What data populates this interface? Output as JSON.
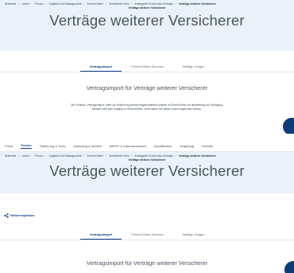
{
  "breadcrumb": {
    "items": [
      "Startseite",
      "Leben",
      "Firmen",
      "Digitales bAV-Management",
      "FirmenOnline",
      "Vertiefende Infos",
      "Arbeitgeber-Portal bAV-Verträge"
    ],
    "current": "Verträge weiterer Versicherer"
  },
  "page_title": "Verträge weiterer Versicherer",
  "top_nav": [
    "Privat",
    "Firmen",
    "Tarifierung & Tools",
    "Marketing & Medien",
    "BiPRO & Datenaustausch",
    "Qualifikation",
    "Vergütung",
    "Kontakt"
  ],
  "top_nav_active": "Firmen",
  "tabs": [
    "Vertragsimport",
    "FirmenOnline Services",
    "Häufige Fragen"
  ],
  "active_tab": "Vertragsimport",
  "section_title": "Vertragsimport für Verträge weiterer Versicherer",
  "intro_text": {
    "line1": "Die Funktion „Vertragsimport“ steht zur Einführung bereits freigeschalteten Nutzern in FirmenOnline zur Bearbeitung zur Verfügung.",
    "line2": "Besteht noch kein Zugang zu FirmenOnline, muss dieser wie üblich vorab eingerichtet werden."
  },
  "share_label": "Weiterempfehlen",
  "colors": {
    "hero_bg": "#e9f2fb",
    "accent": "#0b3a86",
    "fab": "#0d3c7a"
  },
  "icons": {
    "share": "share-icon",
    "fab": "chat-icon"
  }
}
